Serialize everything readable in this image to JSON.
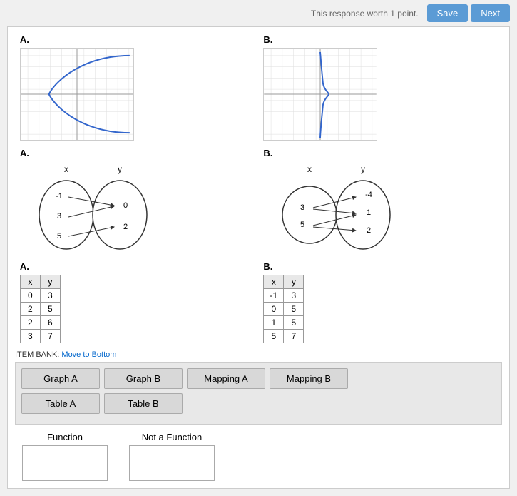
{
  "topbar": {
    "hint_text": "This response worth 1 point.",
    "save_label": "Save",
    "next_label": "Next"
  },
  "graphs": {
    "graph_a_label": "A.",
    "graph_b_label": "B."
  },
  "mappings": {
    "mapping_a_label": "A.",
    "mapping_b_label": "B.",
    "mapping_a": {
      "x_label": "x",
      "y_label": "y",
      "x_values": [
        "-1",
        "3",
        "5"
      ],
      "y_values": [
        "0",
        "2"
      ]
    },
    "mapping_b": {
      "x_label": "x",
      "y_label": "y",
      "x_values": [
        "3",
        "5"
      ],
      "y_values": [
        "-4",
        "1",
        "2"
      ]
    }
  },
  "tables": {
    "table_a_label": "A.",
    "table_b_label": "B.",
    "table_a": {
      "headers": [
        "x",
        "y"
      ],
      "rows": [
        [
          "0",
          "3"
        ],
        [
          "2",
          "5"
        ],
        [
          "2",
          "6"
        ],
        [
          "3",
          "7"
        ]
      ]
    },
    "table_b": {
      "headers": [
        "x",
        "y"
      ],
      "rows": [
        [
          "-1",
          "3"
        ],
        [
          "0",
          "5"
        ],
        [
          "1",
          "5"
        ],
        [
          "5",
          "7"
        ]
      ]
    }
  },
  "item_bank": {
    "label": "ITEM BANK:",
    "move_to_bottom": "Move to Bottom",
    "buttons": [
      {
        "id": "graph-a",
        "label": "Graph A"
      },
      {
        "id": "graph-b",
        "label": "Graph B"
      },
      {
        "id": "mapping-a",
        "label": "Mapping A"
      },
      {
        "id": "mapping-b",
        "label": "Mapping B"
      },
      {
        "id": "table-a",
        "label": "Table A"
      },
      {
        "id": "table-b",
        "label": "Table B"
      }
    ]
  },
  "drop_zones": {
    "function_label": "Function",
    "not_function_label": "Not a Function"
  }
}
